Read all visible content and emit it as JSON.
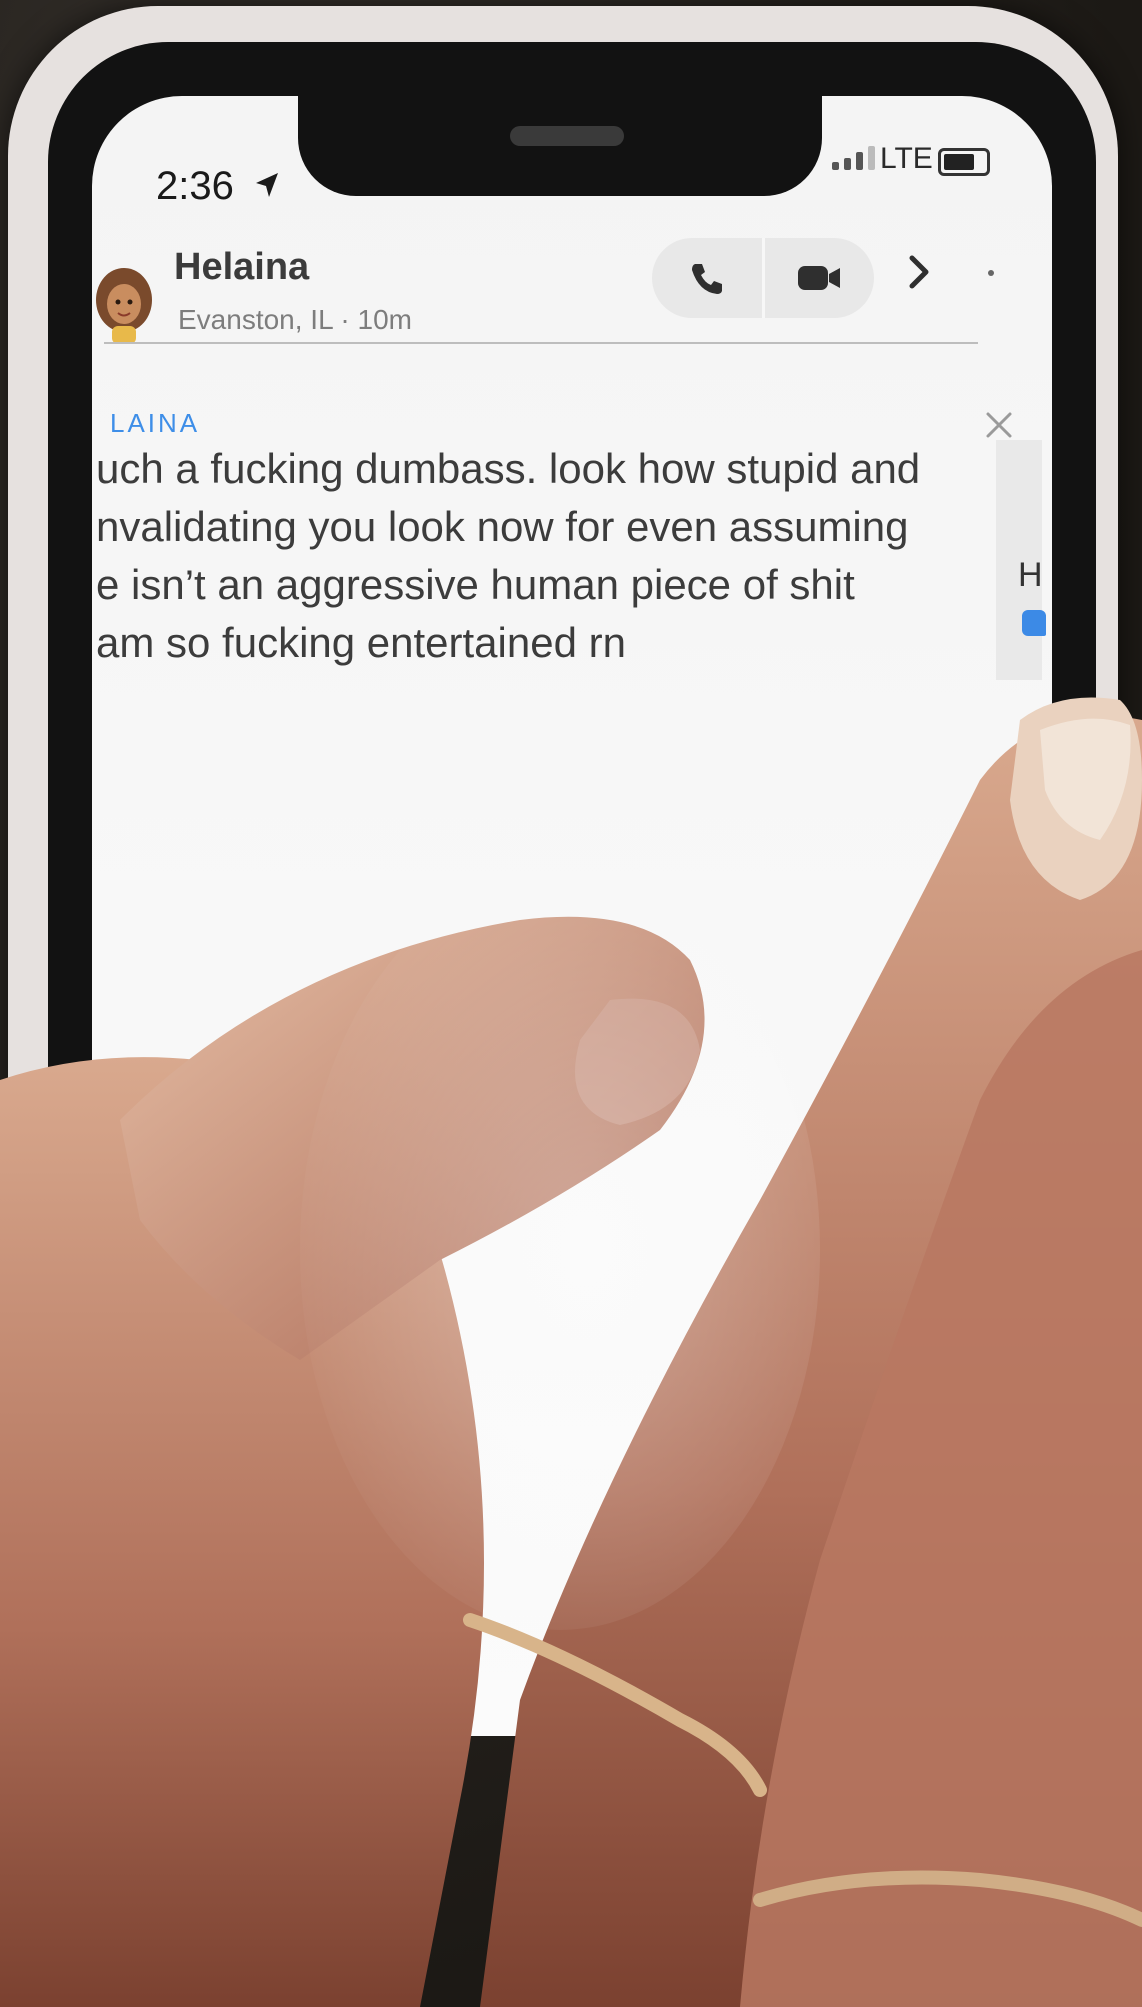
{
  "status_bar": {
    "time": "2:36",
    "network": "LTE"
  },
  "chat_header": {
    "contact_name": "Helaina",
    "contact_subtitle": "Evanston, IL · 10m",
    "icons": [
      "phone-icon",
      "video-camera-icon",
      "chevron-right-icon"
    ]
  },
  "message": {
    "sender": "LAINA",
    "lines": [
      "uch a fucking dumbass. look how stupid and",
      "nvalidating you look now for even assuming",
      "e isn’t an aggressive human piece of shit",
      "am so fucking entertained rn"
    ]
  },
  "side_preview": {
    "letter": "H"
  },
  "colors": {
    "sender_blue": "#3e8ee8",
    "screen_bg": "#f7f7f7",
    "case": "#e6e1df"
  }
}
